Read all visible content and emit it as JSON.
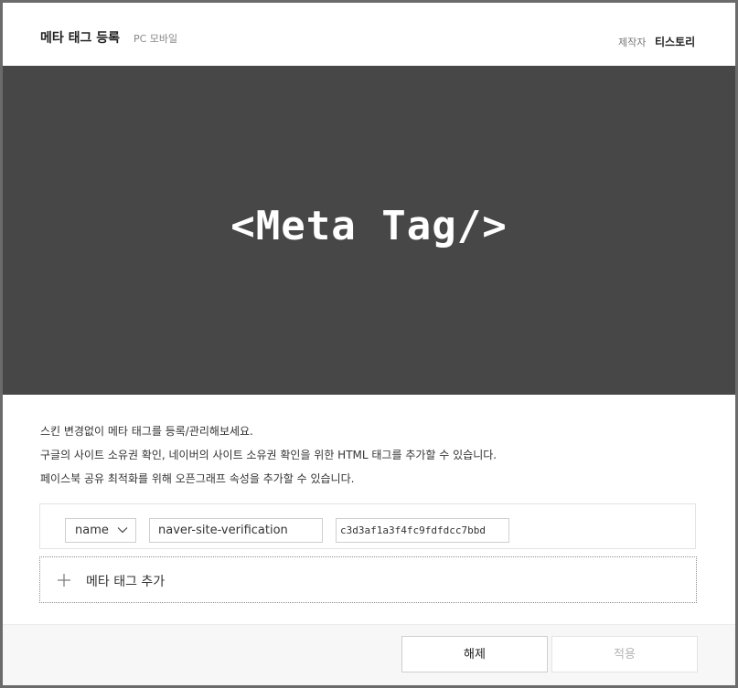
{
  "header": {
    "title": "메타 태그 등록",
    "subtitle": "PC 모바일",
    "maker_label": "제작자",
    "maker_value": "티스토리"
  },
  "banner": {
    "text": "<Meta Tag/>",
    "background": "#474747"
  },
  "description": {
    "lines": [
      "스킨 변경없이 메타 태그를 등록/관리해보세요.",
      "구글의 사이트 소유권 확인, 네이버의 사이트 소유권 확인을 위한 HTML 태그를 추가할 수 있습니다.",
      "페이스북 공유 최적화를 위해 오픈그래프 속성을 추가할 수 있습니다."
    ]
  },
  "meta_row": {
    "attribute_select": "name",
    "key_value": "naver-site-verification",
    "content_value": "c3d3af1a3f4fc9fdfdcc7bbd",
    "icons": {
      "select_arrow": "chevron-down-icon"
    }
  },
  "add_row": {
    "label": "메타 태그 추가",
    "icon": "plus-icon"
  },
  "footer": {
    "release_label": "해제",
    "apply_label": "적용"
  }
}
